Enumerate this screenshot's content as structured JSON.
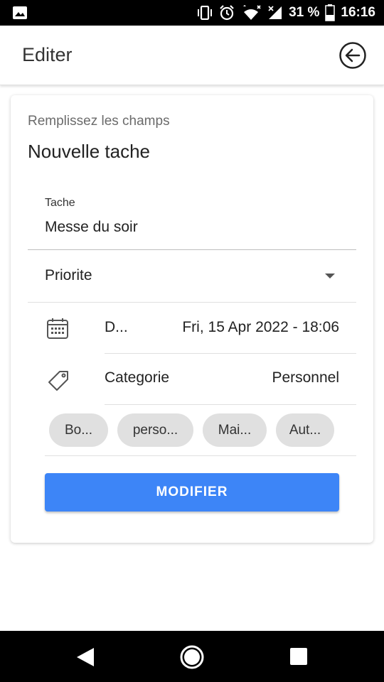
{
  "status_bar": {
    "battery_percent": "31 %",
    "time": "16:16"
  },
  "app_bar": {
    "title": "Editer",
    "back_icon": "arrow-left-circle-icon"
  },
  "form": {
    "subtitle": "Remplissez les champs",
    "title": "Nouvelle tache",
    "task_field": {
      "label": "Tache",
      "value": "Messe du soir"
    },
    "priority": {
      "label": "Priorite"
    },
    "date_row": {
      "label": "D...",
      "value": "Fri, 15 Apr 2022 - 18:06"
    },
    "category_row": {
      "label": "Categorie",
      "value": "Personnel"
    },
    "chips": [
      "Bo...",
      "perso...",
      "Mai...",
      "Aut..."
    ],
    "submit_label": "MODIFIER"
  },
  "colors": {
    "accent": "#3d85f7",
    "chip_bg": "#e0e0e0"
  }
}
